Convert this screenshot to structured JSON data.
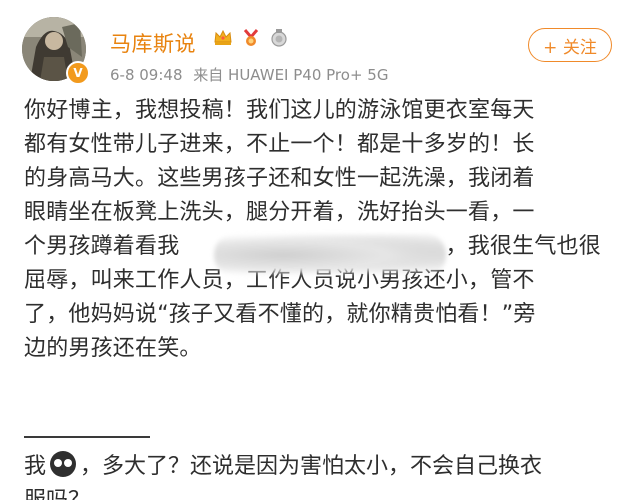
{
  "header": {
    "username": "马库斯说",
    "meta": {
      "date": "6-8 09:48",
      "source": "来自 HUAWEI P40 Pro+ 5G"
    },
    "follow_label": "+ 关注",
    "badges": [
      "crown-badge-icon",
      "medal-badge-icon",
      "ribbon-badge-icon"
    ],
    "avatar_badge": "V"
  },
  "post": {
    "lines": [
      "你好博主，我想投稿！我们这儿的游泳馆更衣室每天",
      "都有女性带儿子进来，不止一个！都是十多岁的！长",
      "的身高马大。这些男孩子还和女性一起洗澡，我闭着",
      "眼睛坐在板凳上洗头，腿分开着，洗好抬头一看，一",
      "个男孩蹲着看我                                     ，我很生气也很",
      "屈辱，叫来工作人员，工作人员说小男孩还小，管不",
      "了，他妈妈说“孩子又看不懂的，就你精贵怕看！”旁",
      "边的男孩还在笑。"
    ]
  },
  "reply": {
    "prefix": "我",
    "emoji": "cool-face-icon",
    "text": "，多大了？还说是因为害怕太小，不会自己换衣",
    "line2": "服吗？"
  },
  "colors": {
    "username": "#e8830f",
    "follow": "#f08a2a",
    "meta": "#8d8d8d",
    "text": "#2e2e2e"
  }
}
